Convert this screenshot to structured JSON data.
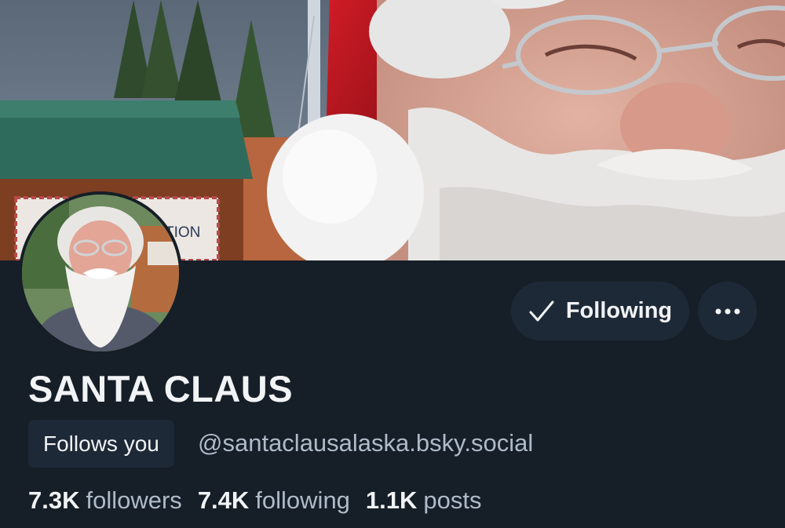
{
  "profile": {
    "display_name": "SANTA CLAUS",
    "follows_you_label": "Follows you",
    "handle": "@santaclausalaska.bsky.social",
    "banner_sign_text": "TION"
  },
  "actions": {
    "following_label": "Following",
    "check_icon": "check-icon",
    "more_icon": "more-horizontal-icon"
  },
  "stats": {
    "followers_count": "7.3K",
    "followers_label": "followers",
    "following_count": "7.4K",
    "following_label": "following",
    "posts_count": "1.1K",
    "posts_label": "posts"
  },
  "colors": {
    "background": "#161e27",
    "button_bg": "#1e2937",
    "text_primary": "#f1f3f5",
    "text_secondary": "#aebbc9"
  }
}
